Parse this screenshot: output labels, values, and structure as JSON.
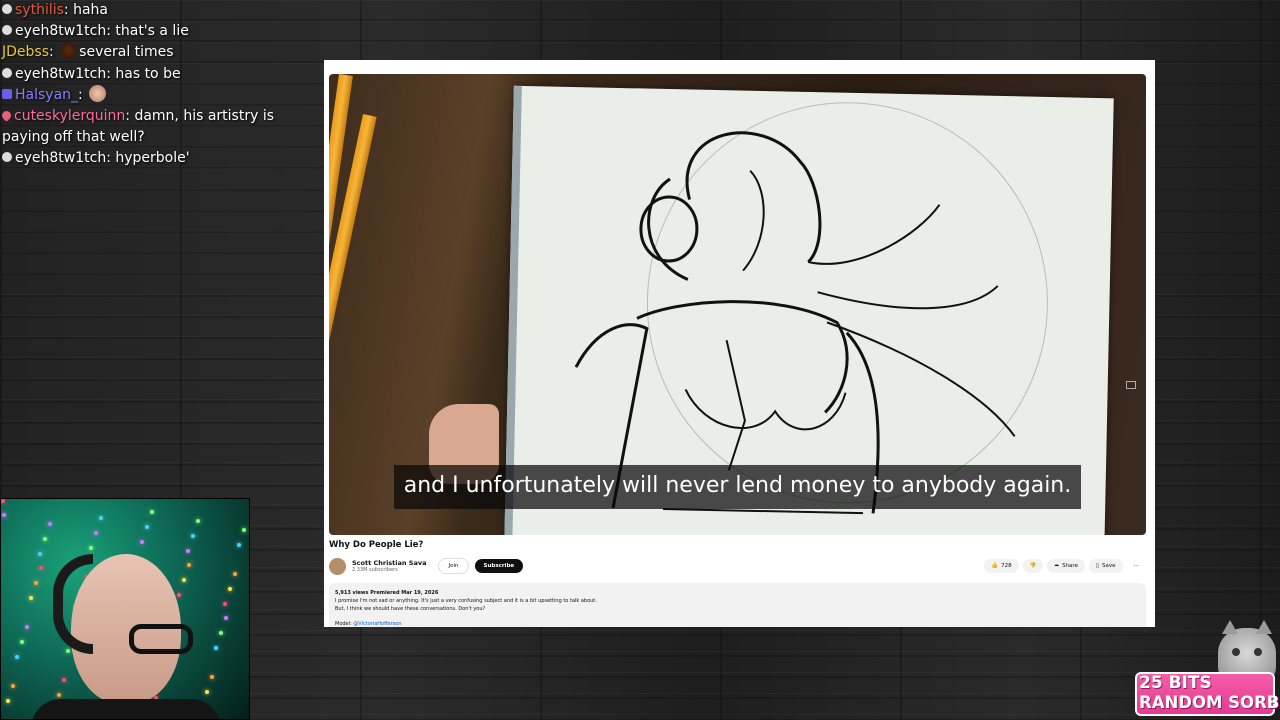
{
  "chat": {
    "messages": [
      {
        "user": "sythilis",
        "separator": ":",
        "text": "haha",
        "user_color": "#e05a3a",
        "badge": "broadcaster-icon"
      },
      {
        "user": "eyeh8tw1tch",
        "separator": ":",
        "text": "that's a lie",
        "user_color": "#ffffff",
        "badge": "egg-icon"
      },
      {
        "user": "JDebss",
        "separator": ":",
        "text": "several times",
        "user_color": "#e8c832",
        "badge": "",
        "emote": "coin-emote"
      },
      {
        "user": "eyeh8tw1tch",
        "separator": ":",
        "text": "has to be",
        "user_color": "#ffffff",
        "badge": "egg-icon"
      },
      {
        "user": "Halsyan_",
        "separator": ":",
        "text": "",
        "user_color": "#8a7cff",
        "badge": "sub-badge-icon",
        "emote": "face-emote"
      },
      {
        "user": "cuteskylerquinn",
        "separator": ":",
        "text": "damn, his artistry is paying off that well?",
        "user_color": "#ff6b9a",
        "badge": "heart-icon"
      },
      {
        "user": "eyeh8tw1tch",
        "separator": ":",
        "text": "hyperbole'",
        "user_color": "#ffffff",
        "badge": "egg-icon"
      }
    ]
  },
  "video": {
    "caption": "and I unfortunately will never lend money to anybody again.",
    "title": "Why Do People Lie?",
    "channel": "Scott Christian Sava",
    "subscribers": "2.33M subscribers",
    "join_label": "Join",
    "subscribe_label": "Subscribe",
    "like_count": "728",
    "share_label": "Share",
    "save_label": "Save",
    "meta": "5,913 views  Premiered Mar 19, 2026",
    "description_line1": "I promise I'm not sad or anything. It's just a very confusing subject and it is a bit upsetting to talk about.",
    "description_line2": "But, I think we should have these conversations. Don't you?",
    "model_label": "Model:",
    "model_handle": "@VictoriaHofferson"
  },
  "alert": {
    "bits": "25 BITS",
    "name": "RANDOM SORB"
  },
  "colors": {
    "alert_pink": "#e53a93",
    "subscribe_bg": "#0f0f0f",
    "webcam_green": "#0e6b57"
  }
}
